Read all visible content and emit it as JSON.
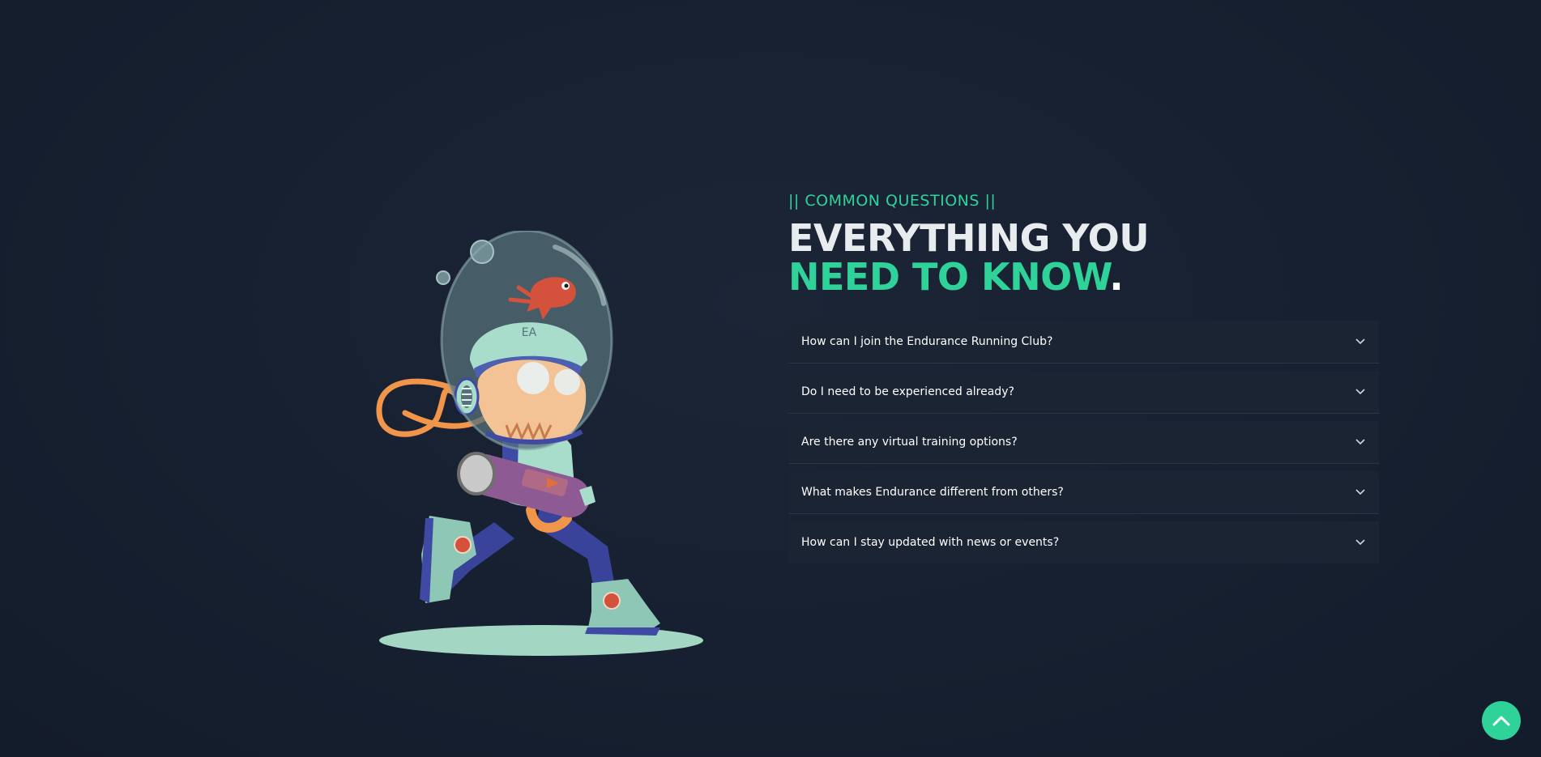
{
  "faq": {
    "eyebrow": "|| COMMON QUESTIONS ||",
    "heading_line1": "EVERYTHING YOU",
    "heading_line2": "NEED TO KNOW",
    "heading_dot": ".",
    "items": [
      {
        "question": "How can I join the Endurance Running Club?",
        "icon": "chevron-down-icon"
      },
      {
        "question": "Do I need to be experienced already?",
        "icon": "chevron-down-icon"
      },
      {
        "question": "Are there any virtual training options?",
        "icon": "chevron-down-icon"
      },
      {
        "question": "What makes Endurance different from others?",
        "icon": "chevron-down-icon"
      },
      {
        "question": "How can I stay updated with news or events?",
        "icon": "chevron-down-icon"
      }
    ]
  },
  "illustration": {
    "subject": "skeleton-astronaut-runner"
  },
  "scroll_top": {
    "icon": "chevron-up-icon"
  },
  "colors": {
    "accent": "#2fd39a",
    "background": "#16202f",
    "card": "#1b2433",
    "text": "#ffffff"
  }
}
